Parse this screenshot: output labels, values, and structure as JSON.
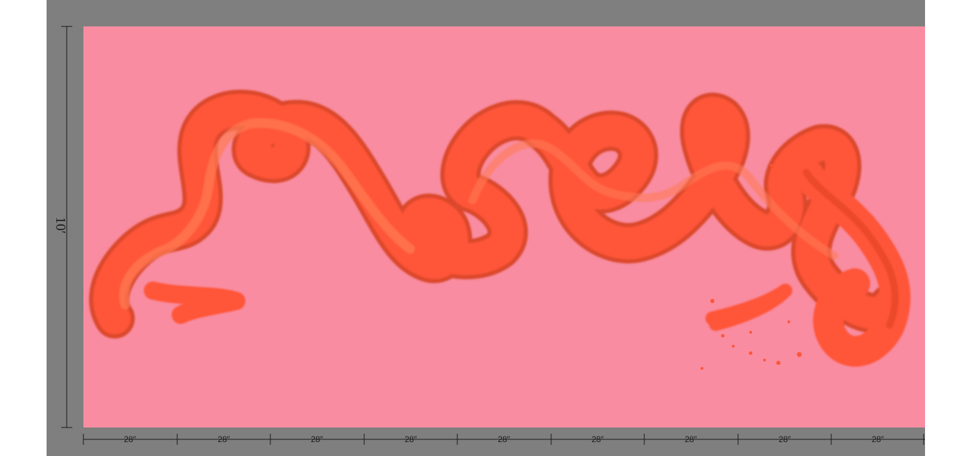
{
  "artwork": {
    "background_color": "#f98ca1",
    "frame_color": "#7f7f7f",
    "stroke_color": "#ff5537",
    "stroke_shadow_color": "#d8401f",
    "height_label": "10′",
    "panel_labels": [
      "28″",
      "28″",
      "28″",
      "28″",
      "28″",
      "28″",
      "28″",
      "28″",
      "28″"
    ]
  }
}
